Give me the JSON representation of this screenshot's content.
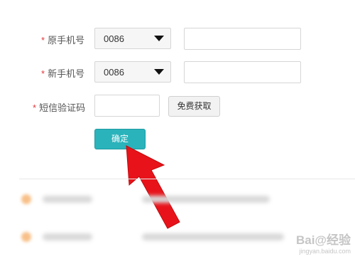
{
  "form": {
    "old_phone": {
      "label": "原手机号",
      "country_code": "0086",
      "value": ""
    },
    "new_phone": {
      "label": "新手机号",
      "country_code": "0086",
      "value": ""
    },
    "sms_code": {
      "label": "短信验证码",
      "value": "",
      "get_code_label": "免费获取"
    },
    "required_mark": "*",
    "confirm_label": "确定"
  },
  "colors": {
    "required": "#e4393c",
    "confirm_button": "#2ab3bb",
    "arrow": "#e8131a"
  },
  "watermark": {
    "text": "Bai@经验",
    "sub": "jingyan.baidu.com"
  }
}
